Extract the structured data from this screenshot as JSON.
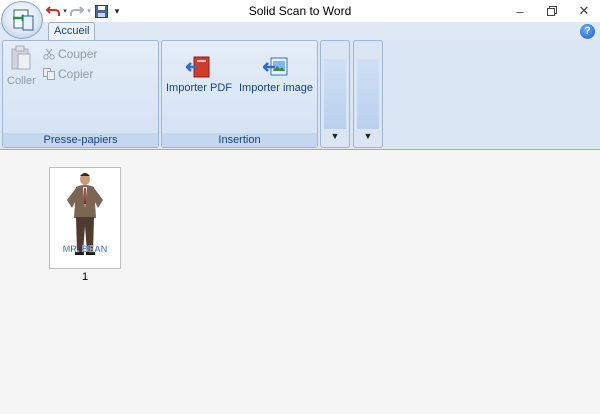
{
  "window": {
    "title": "Solid Scan to Word"
  },
  "tabs": [
    {
      "label": "Accueil"
    }
  ],
  "ribbon": {
    "clipboard": {
      "label": "Presse-papiers",
      "paste": "Coller",
      "cut": "Couper",
      "copy": "Copier"
    },
    "insertion": {
      "label": "Insertion",
      "import_pdf": "Importer PDF",
      "import_image": "Importer image"
    }
  },
  "document": {
    "pages": [
      {
        "number": "1",
        "caption": "MR. BEAN"
      }
    ]
  },
  "colors": {
    "ribbon": "#dbe6f4",
    "tab_text": "#15428b",
    "pdf_red": "#d23a2a",
    "image_blue": "#2f6fc7"
  }
}
